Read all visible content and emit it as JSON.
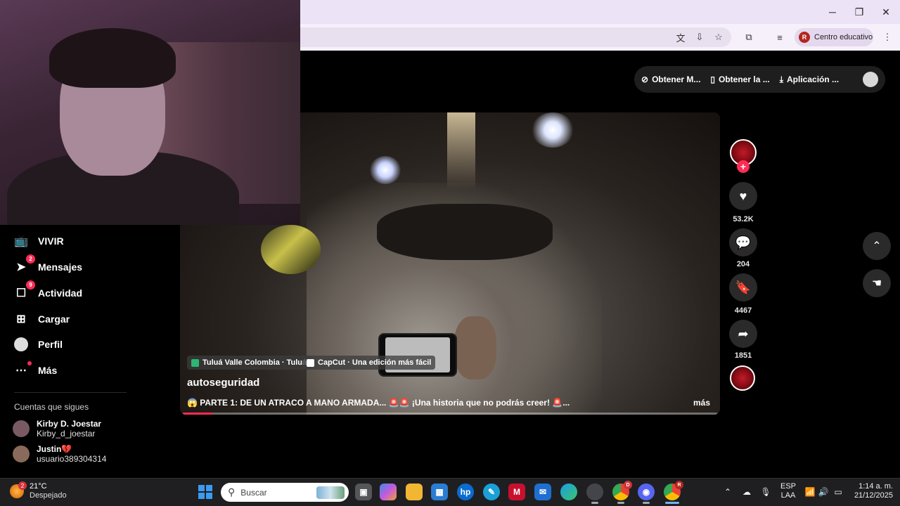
{
  "browser": {
    "profile_initial": "R",
    "profile_label": "Centro educativo",
    "window_controls": [
      "minimize-icon",
      "restore-icon",
      "close-icon"
    ],
    "toolbar_icons": [
      "translate-icon",
      "install-icon",
      "star-icon",
      "extensions-icon",
      "media-icon",
      "menu-icon"
    ]
  },
  "tiktok": {
    "topbar": {
      "btn1": "Obtener M...",
      "btn2": "Obtener la ...",
      "btn3": "Aplicación ..."
    },
    "sidebar": {
      "items": [
        {
          "label": "VIVIR",
          "icon": "live-icon"
        },
        {
          "label": "Mensajes",
          "icon": "messages-icon",
          "badge": "2"
        },
        {
          "label": "Actividad",
          "icon": "activity-icon",
          "badge": "9"
        },
        {
          "label": "Cargar",
          "icon": "upload-icon"
        },
        {
          "label": "Perfil",
          "icon": "profile-icon"
        },
        {
          "label": "Más",
          "icon": "more-icon"
        }
      ],
      "following_title": "Cuentas que sigues",
      "following": [
        {
          "name": "Kirby D. Joestar",
          "user": "Kirby_d_joestar"
        },
        {
          "name": "Justin💔",
          "user": "usuario389304314"
        }
      ]
    },
    "video": {
      "tag1": "Tuluá Valle Colombia · Tuluá",
      "tag2": "CapCut · Una edición más fácil",
      "title": "autoseguridad",
      "description": "😱 PARTE 1: DE UN ATRACO A MANO ARMADA... 🚨🚨 ¡Una historia que no podrás creer! 🚨...",
      "more": "más",
      "progress": 0.055
    },
    "actions": {
      "likes": "53.2K",
      "comments": "204",
      "saves": "4467",
      "shares": "1851"
    }
  },
  "taskbar": {
    "weather_badge": "2",
    "temperature": "21°C",
    "condition": "Despejado",
    "search_placeholder": "Buscar",
    "lang_top": "ESP",
    "lang_bottom": "LAA",
    "time": "1:14 a. m.",
    "date": "21/12/2025",
    "discord_badge": "D",
    "chrome_badge": "R"
  }
}
